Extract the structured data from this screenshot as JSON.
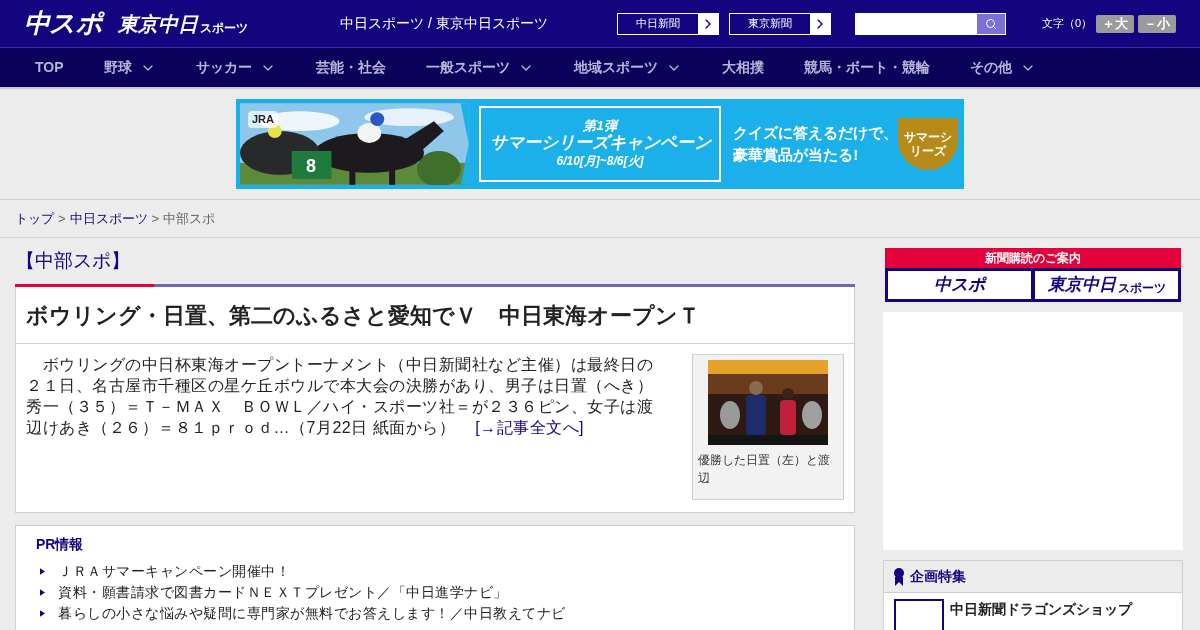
{
  "header": {
    "logo_main": "中スポ",
    "logo_sub": "東京中日",
    "logo_sub_small": "スポーツ",
    "tagline": "中日スポーツ / 東京中日スポーツ",
    "paper_links": [
      "中日新聞",
      "東京新聞"
    ],
    "font_size_label": "文字（0）",
    "font_buttons": [
      "＋大",
      "－小"
    ]
  },
  "nav": [
    {
      "label": "TOP",
      "dropdown": false
    },
    {
      "label": "野球",
      "dropdown": true
    },
    {
      "label": "サッカー",
      "dropdown": true
    },
    {
      "label": "芸能・社会",
      "dropdown": false
    },
    {
      "label": "一般スポーツ",
      "dropdown": true
    },
    {
      "label": "地域スポーツ",
      "dropdown": true
    },
    {
      "label": "大相撲",
      "dropdown": false
    },
    {
      "label": "競馬・ボート・競輪",
      "dropdown": false
    },
    {
      "label": "その他",
      "dropdown": true
    }
  ],
  "banner": {
    "brand": "JRA",
    "number_label": "8",
    "round": "第1弾",
    "title": "サマーシリーズキャンペーン",
    "dates": "6/10[月]~8/6[火]",
    "pitch": [
      "クイズに答えるだけで、",
      "豪華賞品が当たる!"
    ],
    "badge": "サマーシリーズ"
  },
  "breadcrumb": {
    "separator": ">",
    "items": [
      {
        "label": "トップ",
        "link": true
      },
      {
        "label": "中日スポーツ",
        "link": true
      },
      {
        "label": "中部スポ",
        "link": false
      }
    ]
  },
  "section_title": "【中部スポ】",
  "article": {
    "headline": "ボウリング・日置、第二のふるさと愛知でＶ　中日東海オープンＴ",
    "body": "　ボウリングの中日杯東海オープントーナメント（中日新聞社など主催）は最終日の２１日、名古屋市千種区の星ケ丘ボウルで本大会の決勝があり、男子は日置（へき）秀一（３５）＝Ｔ－ＭＡＸ　ＢＯＷＬ／ハイ・スポーツ社＝が２３６ピン、女子は渡辺けあき（２６）＝８１ｐｒｏｄ…（7月22日 紙面から）",
    "more_link": "[→記事全文へ]",
    "photo": {
      "kind": "picture",
      "caption": "優勝した日置（左）と渡辺"
    }
  },
  "pr": {
    "title": "PR情報",
    "items": [
      "ＪＲＡサマーキャンペーン開催中！",
      "資料・願書請求で図書カードＮＥＸＴプレゼント／「中日進学ナビ」",
      "暮らしの小さな悩みや疑問に専門家が無料でお答えします！／中日教えてナビ"
    ]
  },
  "sidebar": {
    "subscribe_title": "新聞購読のご案内",
    "subscribe_buttons": [
      {
        "main": "中スポ"
      },
      {
        "main": "東京中日",
        "small": "スポーツ"
      }
    ],
    "feature_title": "企画特集",
    "feature_items": [
      "中日新聞ドラゴンズショップ"
    ]
  }
}
